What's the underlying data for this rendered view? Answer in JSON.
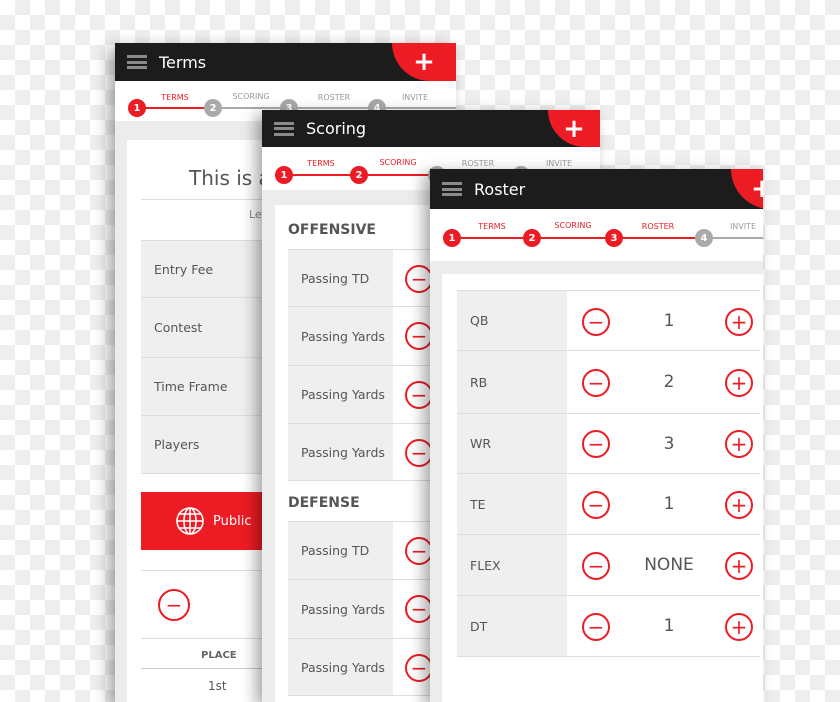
{
  "colors": {
    "accent": "#ed1c24",
    "header": "#1c1c1c",
    "inactive": "#aaaaaa"
  },
  "steps": [
    {
      "num": "1",
      "label": "TERMS"
    },
    {
      "num": "2",
      "label": "SCORING"
    },
    {
      "num": "3",
      "label": "ROSTER"
    },
    {
      "num": "4",
      "label": "INVITE"
    }
  ],
  "terms": {
    "title": "Terms",
    "add": "+",
    "heading": "This is a",
    "subtext": "Le",
    "rows": [
      "Entry Fee",
      "Contest",
      "Time Frame",
      "Players"
    ],
    "public_label": "Public",
    "minus": "−",
    "place_header": "PLACE",
    "place_first": "1st"
  },
  "scoring": {
    "title": "Scoring",
    "add": "+",
    "offensive": "OFFENSIVE",
    "offensive_rows": [
      "Passing TD",
      "Passing Yards",
      "Passing Yards",
      "Passing Yards"
    ],
    "defense": "DEFENSE",
    "defense_rows": [
      "Passing TD",
      "Passing Yards",
      "Passing Yards"
    ],
    "minus": "−"
  },
  "roster": {
    "title": "Roster",
    "add": "+",
    "minus": "−",
    "plus": "+",
    "rows": [
      {
        "pos": "QB",
        "value": "1"
      },
      {
        "pos": "RB",
        "value": "2"
      },
      {
        "pos": "WR",
        "value": "3"
      },
      {
        "pos": "TE",
        "value": "1"
      },
      {
        "pos": "FLEX",
        "value": "NONE"
      },
      {
        "pos": "DT",
        "value": "1"
      }
    ]
  }
}
